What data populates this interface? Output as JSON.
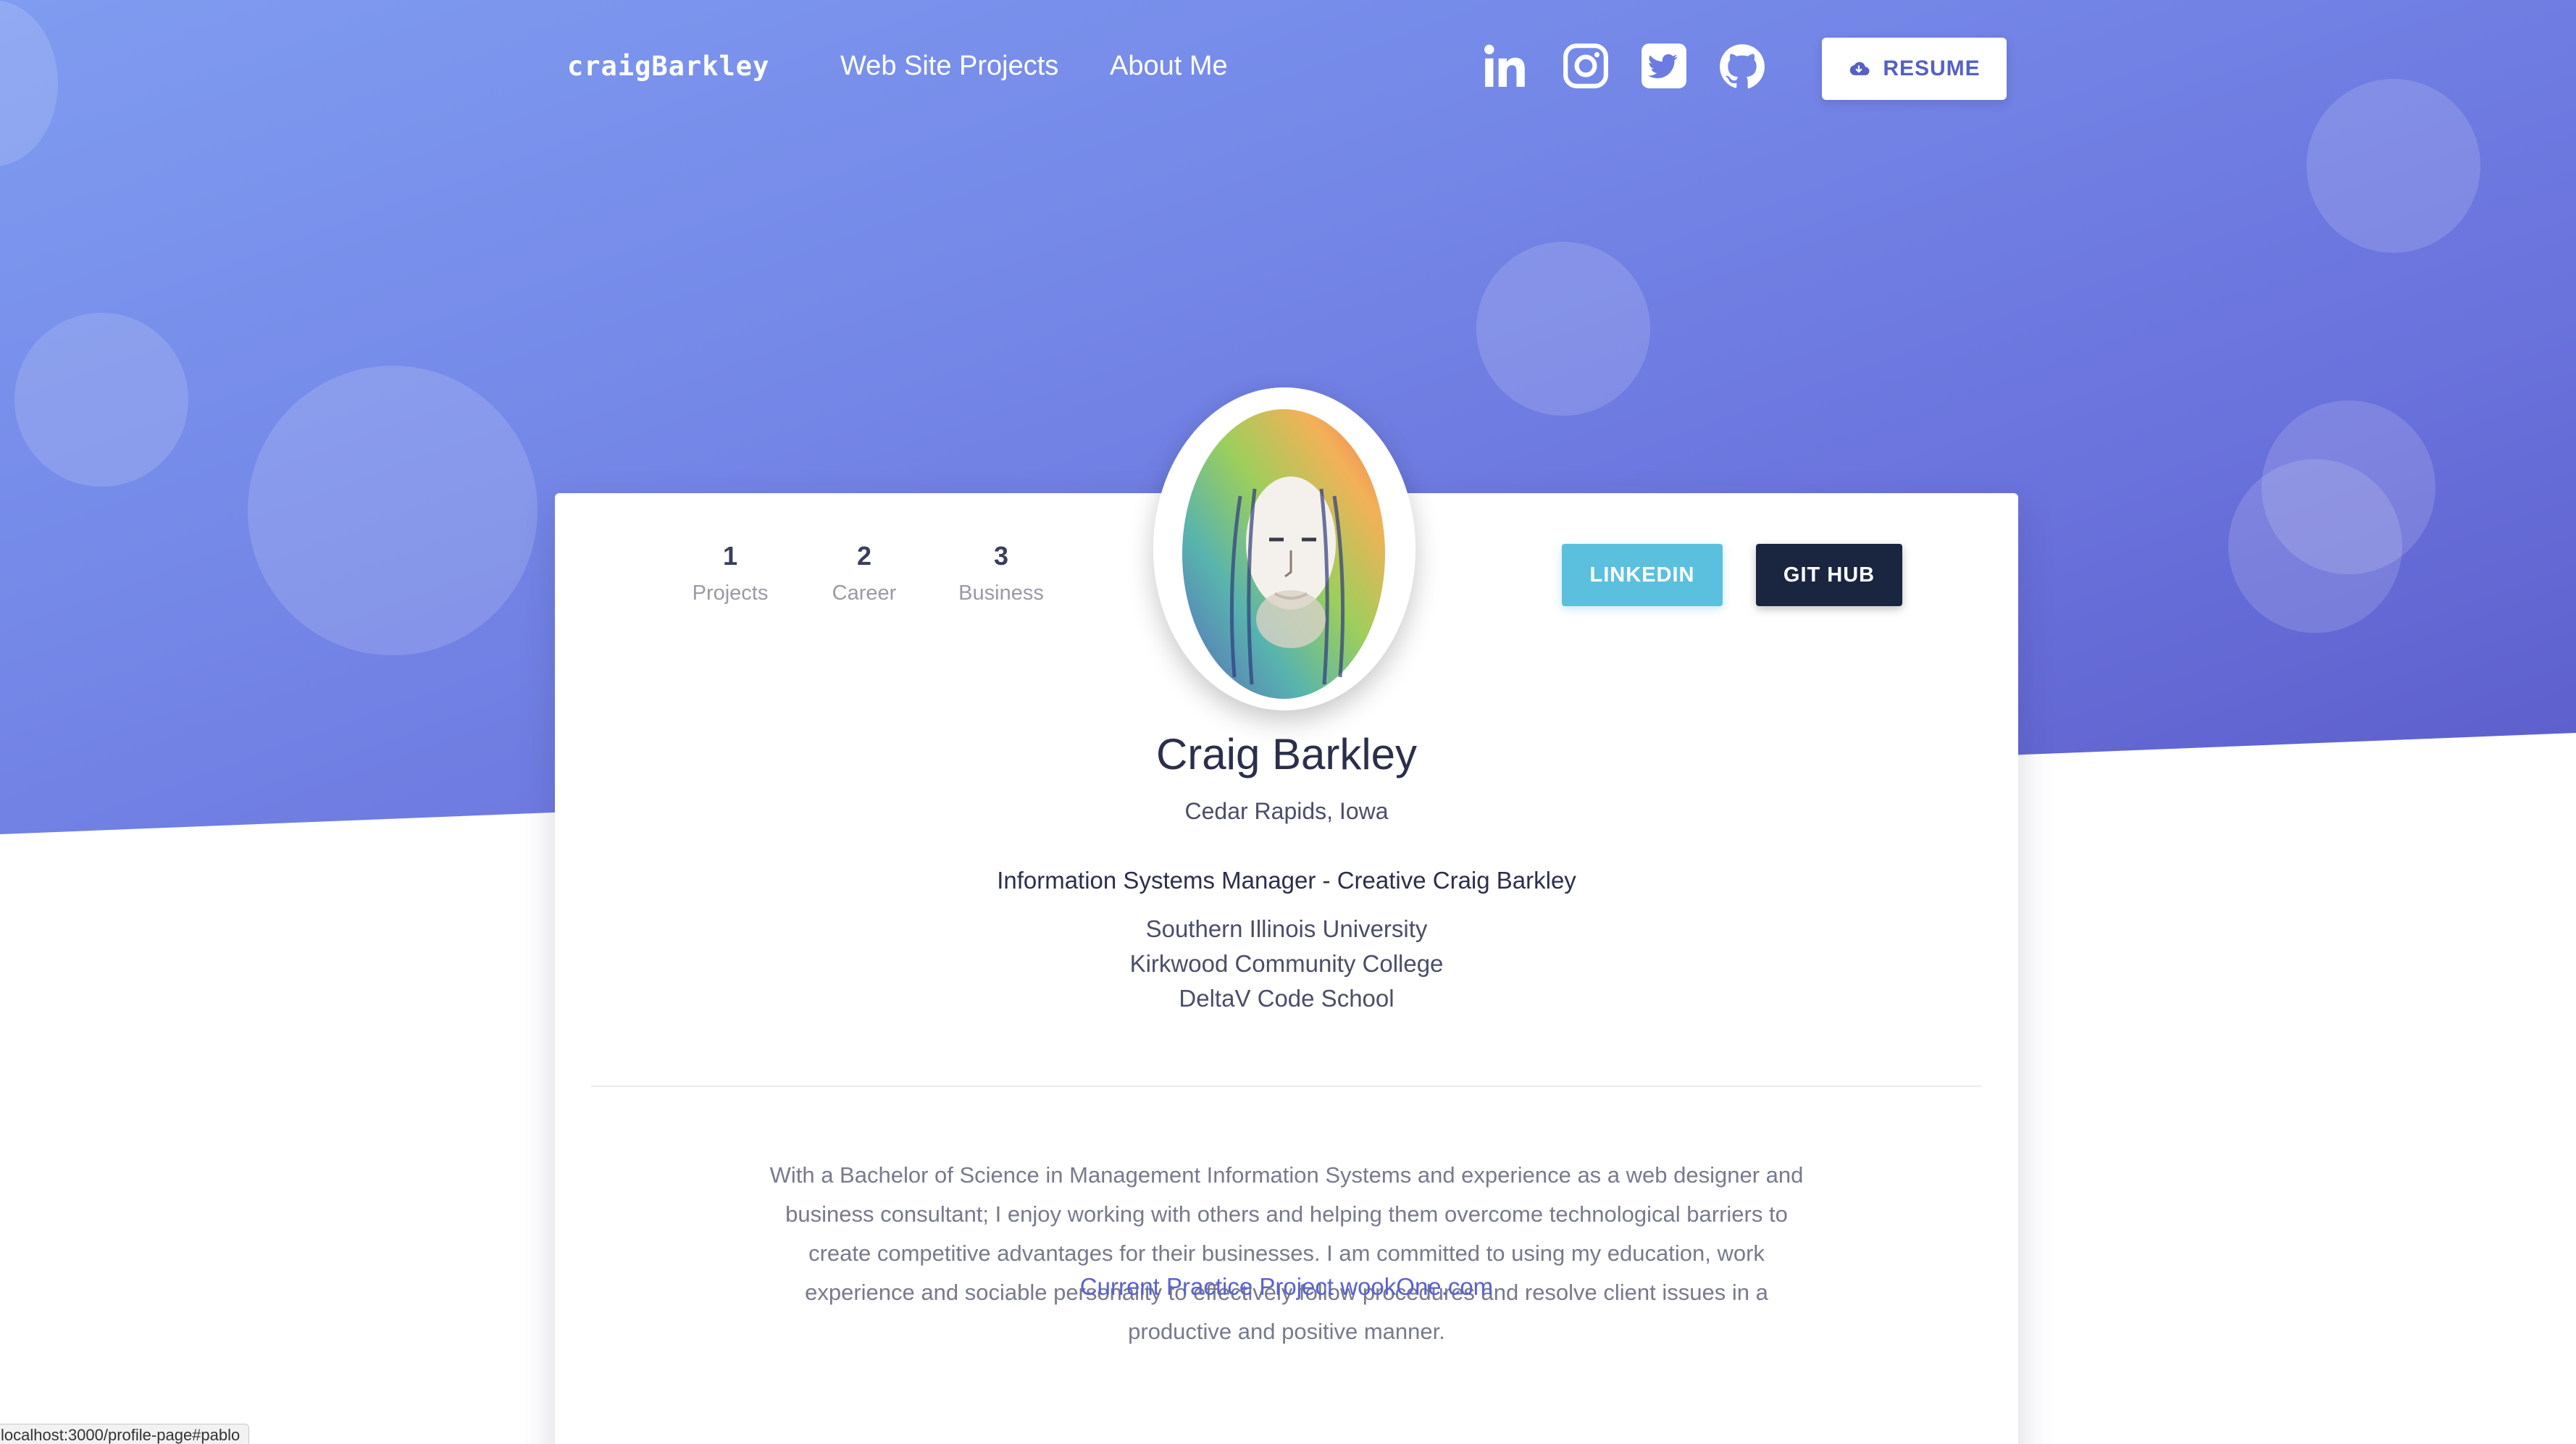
{
  "nav": {
    "brand": "craigBarkley",
    "links": [
      "Web Site Projects",
      "About Me"
    ],
    "social": [
      "linkedin-icon",
      "instagram-icon",
      "twitter-icon",
      "github-icon"
    ],
    "resume_label": "RESUME",
    "resume_icon": "cloud-download-icon"
  },
  "profile": {
    "stats": [
      {
        "value": "1",
        "label": "Projects"
      },
      {
        "value": "2",
        "label": "Career"
      },
      {
        "value": "3",
        "label": "Business"
      }
    ],
    "buttons": {
      "linkedin": "LINKEDIN",
      "github": "GIT HUB"
    },
    "name": "Craig Barkley",
    "location": "Cedar Rapids, Iowa",
    "title": "Information Systems Manager - Creative Craig Barkley",
    "education": [
      "Southern Illinois University",
      "Kirkwood Community College",
      "DeltaV Code School"
    ],
    "bio": "With a Bachelor of Science in Management Information Systems and experience as a web designer and business consultant; I enjoy working with others and helping them overcome technological barriers to create competitive advantages for their businesses. I am committed to using my education, work experience and sociable personality to effectively follow procedures and resolve client issues in a productive and positive manner.",
    "practice_link": "Current Practice Project wookOne.com"
  },
  "status_bar": {
    "url": "localhost:3000/profile-page#pablo"
  },
  "colors": {
    "hero_start": "#7f9cf0",
    "hero_end": "#5b5cc9",
    "linkedin_button": "#5bc0de",
    "github_button": "#1a2540",
    "link": "#5a62d0"
  }
}
